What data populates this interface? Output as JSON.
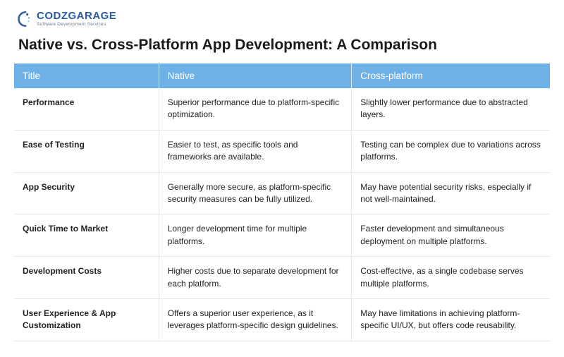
{
  "brand": {
    "name": "CODZGARAGE",
    "tagline": "Software Development Services",
    "color": "#2a5aa8"
  },
  "title": "Native vs. Cross-Platform App Development: A Comparison",
  "chart_data": {
    "type": "table",
    "title": "Native vs. Cross-Platform App Development: A Comparison",
    "columns": [
      "Title",
      "Native",
      "Cross-platform"
    ],
    "rows": [
      {
        "title": "Performance",
        "native": "Superior performance due to platform-specific optimization.",
        "cross": "Slightly lower performance due to abstracted layers."
      },
      {
        "title": "Ease of Testing",
        "native": "Easier to test, as specific tools and frameworks are available.",
        "cross": "Testing can be complex due to variations across platforms."
      },
      {
        "title": "App Security",
        "native": "Generally more secure, as platform-specific security measures can be fully utilized.",
        "cross": "May have potential security risks, especially if not well-maintained."
      },
      {
        "title": "Quick Time to Market",
        "native": "Longer development time for multiple platforms.",
        "cross": "Faster development and simultaneous deployment on multiple platforms."
      },
      {
        "title": "Development Costs",
        "native": "Higher costs due to separate development for each platform.",
        "cross": "Cost-effective, as a single codebase serves multiple platforms."
      },
      {
        "title": "User Experience & App Customization",
        "native": "Offers a superior user experience, as it leverages platform-specific design guidelines.",
        "cross": "May have limitations in achieving platform-specific UI/UX, but offers code reusability."
      }
    ]
  }
}
